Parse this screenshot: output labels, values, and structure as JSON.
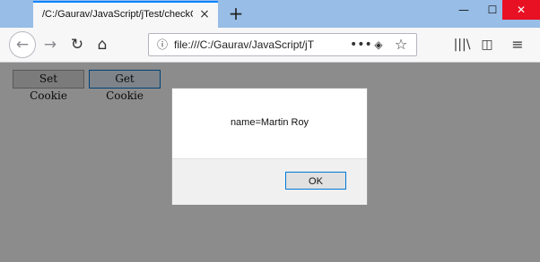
{
  "browser": {
    "tab_title": "/C:/Gaurav/JavaScript/jTest/checkCookie",
    "tab_close_icon": "×",
    "new_tab_icon": "+",
    "window_controls": {
      "minimize": "—",
      "maximize": "☐",
      "close": "✕"
    },
    "nav": {
      "back_icon": "←",
      "forward_icon": "→",
      "reload_icon": "↻",
      "home_icon": "⌂"
    },
    "urlbar": {
      "info_icon": "ⓘ",
      "url": "file:///C:/Gaurav/JavaScript/jT",
      "more_icon": "•••",
      "pocket_icon": "◈",
      "star_icon": "☆"
    },
    "toolbar": {
      "library_icon": "|||\\",
      "sidebar_icon": "◫",
      "menu_icon": "≡"
    }
  },
  "page": {
    "set_cookie_label": "Set Cookie",
    "get_cookie_label": "Get Cookie"
  },
  "dialog": {
    "message": "name=Martin Roy",
    "ok_label": "OK"
  }
}
